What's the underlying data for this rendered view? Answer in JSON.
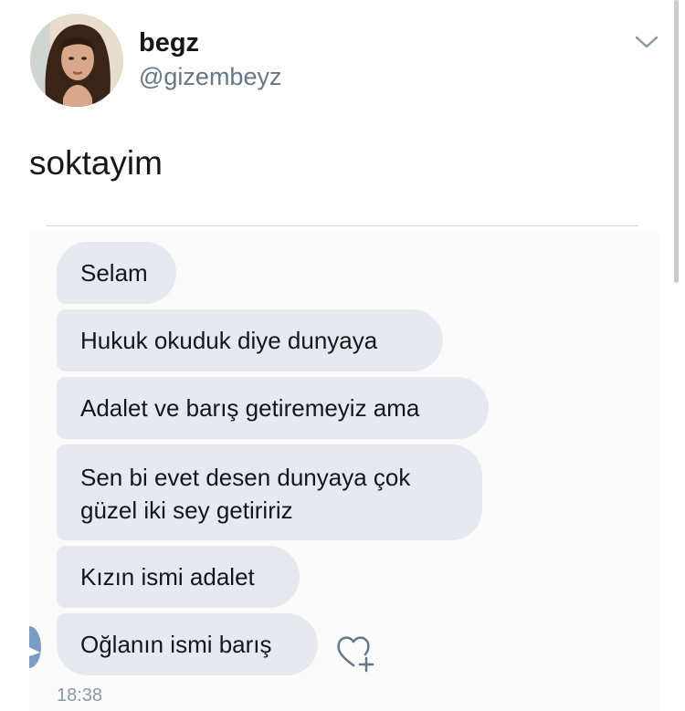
{
  "tweet": {
    "author": {
      "display_name": "begz",
      "handle": "@gizembeyz",
      "avatar_icon": "profile-photo"
    },
    "menu_icon": "chevron-down-icon",
    "text": "soktayim"
  },
  "screenshot": {
    "messages": [
      {
        "text": "Selam"
      },
      {
        "text": "Hukuk okuduk diye dunyaya"
      },
      {
        "text": "Adalet ve barış getiremeyiz ama"
      },
      {
        "text": "Sen bi evet desen dunyaya çok güzel iki sey getiririz"
      },
      {
        "text": "Kızın ismi adalet"
      },
      {
        "text": "Oğlanın ismi barış"
      }
    ],
    "timestamp": "18:38",
    "reaction_icon": "heart-add-icon"
  },
  "colors": {
    "bubble": "#e6e9ef",
    "text": "#14171a",
    "secondary": "#657786"
  }
}
